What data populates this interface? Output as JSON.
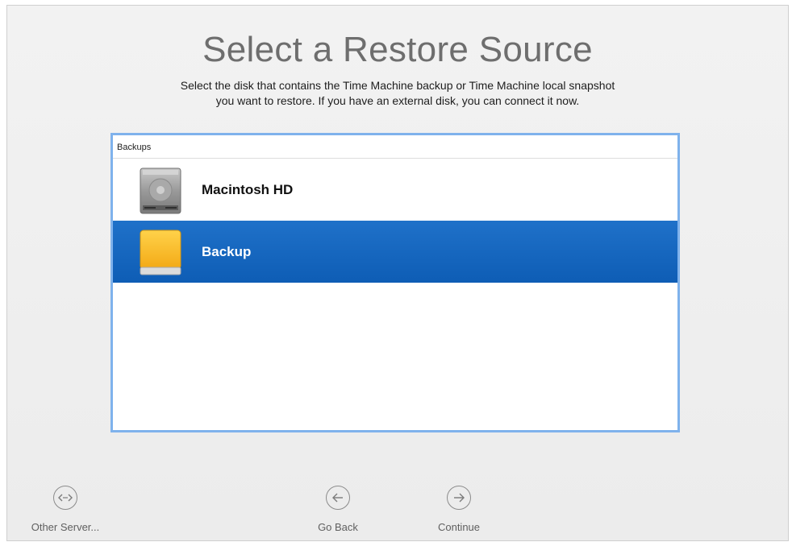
{
  "title": "Select a Restore Source",
  "subtitle_line1": "Select the disk that contains the Time Machine backup or Time Machine local snapshot",
  "subtitle_line2": "you want to restore. If you have an external disk, you can connect it now.",
  "list": {
    "header": "Backups",
    "items": [
      {
        "label": "Macintosh HD",
        "icon": "internal-hard-drive-icon",
        "selected": false
      },
      {
        "label": "Backup",
        "icon": "external-drive-icon",
        "selected": true
      }
    ]
  },
  "buttons": {
    "other_server": {
      "label": "Other Server...",
      "icon": "network-server-icon"
    },
    "go_back": {
      "label": "Go Back",
      "icon": "left-arrow-icon"
    },
    "continue": {
      "label": "Continue",
      "icon": "right-arrow-icon"
    }
  },
  "colors": {
    "selection": "#1366c2",
    "list_focus_border": "#7fb2ec",
    "title_text": "#6e6e6e"
  }
}
